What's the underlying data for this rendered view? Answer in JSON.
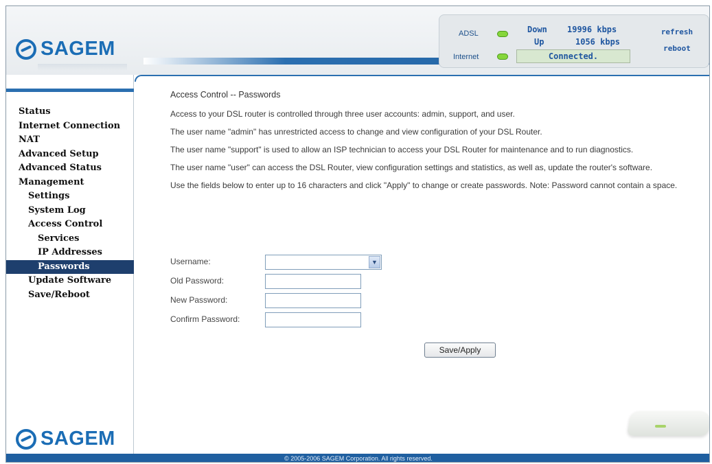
{
  "brand": {
    "name": "SAGEM",
    "color": "#1b6db5"
  },
  "status": {
    "adsl_label": "ADSL",
    "internet_label": "Internet",
    "down_label": "Down",
    "down_value": "19996 kbps",
    "up_label": "Up",
    "up_value": "1056 kbps",
    "connection": "Connected.",
    "refresh_label": "refresh",
    "reboot_label": "reboot",
    "led_color": "#86d63b"
  },
  "sidebar": {
    "items": [
      {
        "label": "Status",
        "level": 0
      },
      {
        "label": "Internet Connection",
        "level": 0
      },
      {
        "label": "NAT",
        "level": 0
      },
      {
        "label": "Advanced Setup",
        "level": 0
      },
      {
        "label": "Advanced Status",
        "level": 0
      },
      {
        "label": "Management",
        "level": 0
      },
      {
        "label": "Settings",
        "level": 1
      },
      {
        "label": "System Log",
        "level": 1
      },
      {
        "label": "Access Control",
        "level": 1
      },
      {
        "label": "Services",
        "level": 2
      },
      {
        "label": "IP Addresses",
        "level": 2
      },
      {
        "label": "Passwords",
        "level": 2,
        "active": true
      },
      {
        "label": "Update Software",
        "level": 1
      },
      {
        "label": "Save/Reboot",
        "level": 1
      }
    ],
    "active_color": "#1e3f6d"
  },
  "main": {
    "title": "Access Control -- Passwords",
    "paragraphs": [
      "Access to your DSL router is controlled through three user accounts: admin, support, and user.",
      "The user name \"admin\" has unrestricted access to change and view configuration of your DSL Router.",
      "The user name \"support\" is used to allow an ISP technician to access your DSL Router for maintenance and to run diagnostics.",
      "The user name \"user\" can access the DSL Router, view configuration settings and statistics, as well as, update the router's software.",
      "Use the fields below to enter up to 16 characters and click \"Apply\" to change or create passwords. Note: Password cannot contain a space."
    ]
  },
  "form": {
    "username_label": "Username:",
    "username_value": "",
    "old_password_label": "Old Password:",
    "new_password_label": "New Password:",
    "confirm_password_label": "Confirm Password:",
    "apply_label": "Save/Apply"
  },
  "footer": {
    "text": "© 2005-2006 SAGEM Corporation. All rights reserved."
  }
}
